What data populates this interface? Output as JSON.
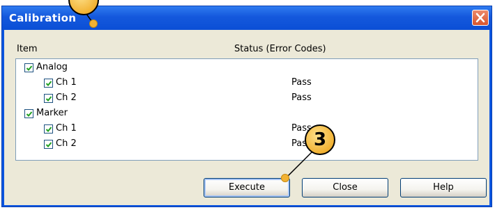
{
  "window": {
    "title": "Calibration",
    "close_icon": "close-icon"
  },
  "columns": {
    "item_header": "Item",
    "status_header": "Status (Error Codes)"
  },
  "tree": [
    {
      "label": "Analog",
      "checked": true,
      "status": ""
    },
    {
      "label": "Ch 1",
      "checked": true,
      "status": "Pass"
    },
    {
      "label": "Ch 2",
      "checked": true,
      "status": "Pass"
    },
    {
      "label": "Marker",
      "checked": true,
      "status": ""
    },
    {
      "label": "Ch 1",
      "checked": true,
      "status": "Pass"
    },
    {
      "label": "Ch 2",
      "checked": true,
      "status": "Pass"
    }
  ],
  "buttons": {
    "execute": "Execute",
    "close": "Close",
    "help": "Help"
  },
  "callout": {
    "number": "3"
  },
  "colors": {
    "titlebar": "#0b55e0",
    "client": "#ece9d8",
    "callout": "#f2b233"
  }
}
